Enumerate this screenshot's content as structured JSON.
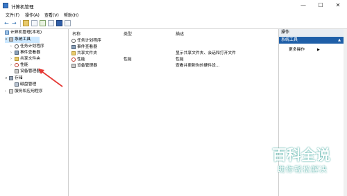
{
  "window": {
    "title": "计算机管理"
  },
  "menu": [
    "文件(F)",
    "操作(A)",
    "查看(V)",
    "帮助(H)"
  ],
  "tree": {
    "root": "计算机管理(本地)",
    "items": [
      {
        "label": "系统工具",
        "selected": true
      },
      {
        "label": "任务计划程序"
      },
      {
        "label": "事件查看器"
      },
      {
        "label": "共享文件夹"
      },
      {
        "label": "性能"
      },
      {
        "label": "设备管理器"
      },
      {
        "label": "存储"
      },
      {
        "label": "磁盘管理"
      },
      {
        "label": "服务和应用程序"
      }
    ]
  },
  "list": {
    "headers": {
      "name": "名称",
      "type": "类型",
      "desc": "描述"
    },
    "rows": [
      {
        "name": "任务计划程序",
        "type": "",
        "desc": ""
      },
      {
        "name": "事件查看器",
        "type": "",
        "desc": ""
      },
      {
        "name": "共享文件夹",
        "type": "",
        "desc": "显示共享文件夹、会话和打开文件"
      },
      {
        "name": "性能",
        "type": "性能",
        "desc": "性能"
      },
      {
        "name": "设备管理器",
        "type": "",
        "desc": "查看并更新你的硬件设..."
      }
    ]
  },
  "actions": {
    "header": "操作",
    "section": "系统工具",
    "more": "更多操作"
  },
  "watermark": {
    "title": "百科全说",
    "subtitle": "助你轻松解决"
  },
  "colors": {
    "selection": "#cce8ff",
    "action_section": "#1f5fa8",
    "arrow": "#e53935"
  }
}
